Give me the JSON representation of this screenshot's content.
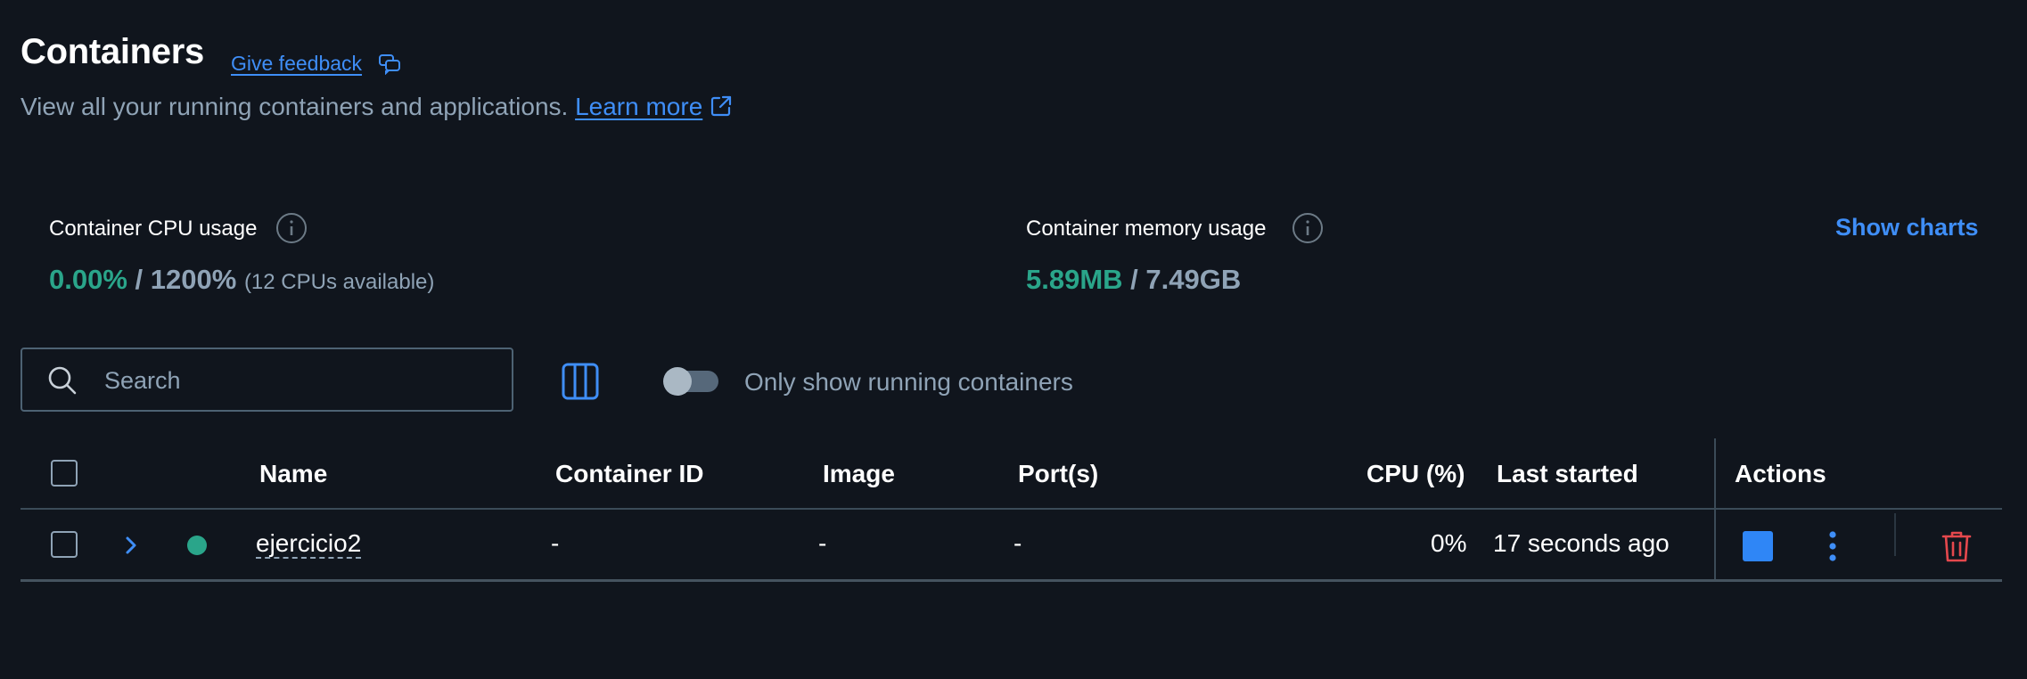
{
  "header": {
    "title": "Containers",
    "feedback_label": "Give feedback",
    "subtitle": "View all your running containers and applications.",
    "learn_more": "Learn more"
  },
  "stats": {
    "cpu": {
      "label": "Container CPU usage",
      "used": "0.00%",
      "separator": "/",
      "total": "1200%",
      "note": "(12 CPUs available)"
    },
    "memory": {
      "label": "Container memory usage",
      "used": "5.89MB",
      "separator": "/",
      "total": "7.49GB"
    },
    "show_charts": "Show charts"
  },
  "toolbar": {
    "search_placeholder": "Search",
    "toggle_label": "Only show running containers",
    "toggle_on": false
  },
  "table": {
    "columns": {
      "name": "Name",
      "container_id": "Container ID",
      "image": "Image",
      "ports": "Port(s)",
      "cpu": "CPU (%)",
      "last_started": "Last started",
      "actions": "Actions"
    },
    "rows": [
      {
        "name": "ejercicio2",
        "container_id": "-",
        "image": "-",
        "ports": "-",
        "cpu": "0%",
        "last_started": "17 seconds ago",
        "status": "running"
      }
    ]
  },
  "colors": {
    "background": "#10151d",
    "accent": "#3f8ef7",
    "running": "#2aa58a",
    "danger": "#e5484d",
    "muted": "#8fa3b6"
  }
}
